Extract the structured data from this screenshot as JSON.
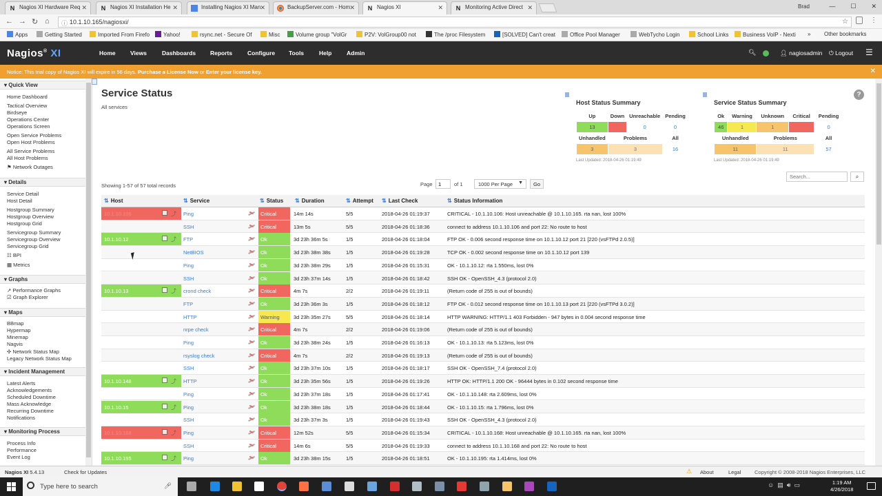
{
  "browser": {
    "tabs": [
      {
        "title": "Nagios XI Hardware Req",
        "favicon": "N"
      },
      {
        "title": "Nagios XI Installation He",
        "favicon": "N"
      },
      {
        "title": "Installing Nagios XI Man",
        "favicon": "doc"
      },
      {
        "title": "BackupServer.com - Hom",
        "favicon": "chrome"
      },
      {
        "title": "Nagios XI",
        "favicon": "N",
        "active": true
      },
      {
        "title": "Monitoring Active Direct",
        "favicon": "N"
      }
    ],
    "window_user": "Brad",
    "url": "10.1.10.165/nagiosxi/",
    "bookmarks": [
      "Apps",
      "Getting Started",
      "Imported From Firefo",
      "Yahoo!",
      "rsync.net - Secure Of",
      "Misc",
      "Volume group \"VolGr",
      "P2V: VolGroup00 not",
      "The /proc Filesystem",
      "[SOLVED] Can't creat",
      "Office Pool Manager",
      "WebTycho Login",
      "School Links",
      "Business VoIP - Nexti",
      "»",
      "Other bookmarks"
    ]
  },
  "header": {
    "logo_main": "Nagios",
    "logo_suffix": "XI",
    "nav": [
      "Home",
      "Views",
      "Dashboards",
      "Reports",
      "Configure",
      "Tools",
      "Help",
      "Admin"
    ],
    "user": "nagiosadmin",
    "logout": "Logout"
  },
  "notice": {
    "text": "Notice: This trial copy of Nagios XI will expire in 56 days.",
    "link1": "Purchase a License Now",
    "mid": "or",
    "link2": "Enter your license key."
  },
  "sidebar": {
    "sections": [
      {
        "title": "Quick View",
        "items": [
          "Home Dashboard",
          "Tactical Overview",
          "Birdseye",
          "Operations Center",
          "Operations Screen",
          "Open Service Problems",
          "Open Host Problems",
          "All Service Problems",
          "All Host Problems",
          "Network Outages"
        ]
      },
      {
        "title": "Details",
        "items": [
          "Service Detail",
          "Host Detail",
          "Hostgroup Summary",
          "Hostgroup Overview",
          "Hostgroup Grid",
          "Servicegroup Summary",
          "Servicegroup Overview",
          "Servicegroup Grid",
          "BPI",
          "Metrics"
        ]
      },
      {
        "title": "Graphs",
        "items": [
          "Performance Graphs",
          "Graph Explorer"
        ]
      },
      {
        "title": "Maps",
        "items": [
          "BBmap",
          "Hypermap",
          "Minemap",
          "Nagvis",
          "Network Status Map",
          "Legacy Network Status Map"
        ]
      },
      {
        "title": "Incident Management",
        "items": [
          "Latest Alerts",
          "Acknowledgements",
          "Scheduled Downtime",
          "Mass Acknowledge",
          "Recurring Downtime",
          "Notifications"
        ]
      },
      {
        "title": "Monitoring Process",
        "items": [
          "Process Info",
          "Performance",
          "Event Log"
        ]
      }
    ]
  },
  "main": {
    "title": "Service Status",
    "subtitle": "All services",
    "showing": "Showing 1-57 of 57 total records",
    "page_label": "Page",
    "page_value": "1",
    "page_of": "of 1",
    "per_page": "1000 Per Page",
    "go": "Go",
    "search_placeholder": "Search..."
  },
  "host_summary": {
    "title": "Host Status Summary",
    "headers": [
      "Up",
      "Down",
      "Unreachable",
      "Pending"
    ],
    "values": [
      "13",
      "3",
      "0",
      "0"
    ],
    "headers2": [
      "Unhandled",
      "Problems",
      "All"
    ],
    "values2": [
      "3",
      "3",
      "16"
    ],
    "last_updated": "Last Updated: 2018-04-26 01:19:49"
  },
  "service_summary": {
    "title": "Service Status Summary",
    "headers": [
      "Ok",
      "Warning",
      "Unknown",
      "Critical",
      "Pending"
    ],
    "values": [
      "46",
      "1",
      "1",
      "9",
      "0"
    ],
    "headers2": [
      "Unhandled",
      "Problems",
      "All"
    ],
    "values2": [
      "11",
      "11",
      "57"
    ],
    "last_updated": "Last Updated: 2018-04-26 01:19:49"
  },
  "table": {
    "headers": [
      "Host",
      "Service",
      "Status",
      "Duration",
      "Attempt",
      "Last Check",
      "Status Information"
    ],
    "rows": [
      {
        "host": "10.1.10.106",
        "host_state": "down",
        "service": "Ping",
        "status": "Critical",
        "duration": "14m 14s",
        "attempt": "5/5",
        "last_check": "2018-04-26 01:19:37",
        "info": "CRITICAL - 10.1.10.106: Host unreachable @ 10.1.10.165. rta nan, lost 100%"
      },
      {
        "host": "",
        "host_state": "",
        "service": "SSH",
        "status": "Critical",
        "duration": "13m 5s",
        "attempt": "5/5",
        "last_check": "2018-04-26 01:18:36",
        "info": "connect to address 10.1.10.106 and port 22: No route to host"
      },
      {
        "host": "10.1.10.12",
        "host_state": "up",
        "service": "FTP",
        "status": "Ok",
        "duration": "3d 23h 36m 5s",
        "attempt": "1/5",
        "last_check": "2018-04-26 01:18:04",
        "info": "FTP OK - 0.006 second response time on 10.1.10.12 port 21 [220 (vsFTPd 2.0.5)]"
      },
      {
        "host": "",
        "host_state": "",
        "service": "NetBIOS",
        "status": "Ok",
        "duration": "3d 23h 38m 38s",
        "attempt": "1/5",
        "last_check": "2018-04-26 01:19:28",
        "info": "TCP OK - 0.002 second response time on 10.1.10.12 port 139"
      },
      {
        "host": "",
        "host_state": "",
        "service": "Ping",
        "status": "Ok",
        "duration": "3d 23h 38m 29s",
        "attempt": "1/5",
        "last_check": "2018-04-26 01:15:31",
        "info": "OK - 10.1.10.12: rta 1.550ms, lost 0%"
      },
      {
        "host": "",
        "host_state": "",
        "service": "SSH",
        "status": "Ok",
        "duration": "3d 23h 37m 14s",
        "attempt": "1/5",
        "last_check": "2018-04-26 01:18:42",
        "info": "SSH OK - OpenSSH_4.3 (protocol 2.0)"
      },
      {
        "host": "10.1.10.13",
        "host_state": "up",
        "service": "crond check",
        "status": "Critical",
        "duration": "4m 7s",
        "attempt": "2/2",
        "last_check": "2018-04-26 01:19:11",
        "info": "(Return code of 255 is out of bounds)"
      },
      {
        "host": "",
        "host_state": "",
        "service": "FTP",
        "status": "Ok",
        "duration": "3d 23h 36m 3s",
        "attempt": "1/5",
        "last_check": "2018-04-26 01:18:12",
        "info": "FTP OK - 0.012 second response time on 10.1.10.13 port 21 [220 (vsFTPd 3.0.2)]"
      },
      {
        "host": "",
        "host_state": "",
        "service": "HTTP",
        "status": "Warning",
        "duration": "3d 23h 35m 27s",
        "attempt": "5/5",
        "last_check": "2018-04-26 01:18:14",
        "info": "HTTP WARNING: HTTP/1.1 403 Forbidden - 947 bytes in 0.004 second response time"
      },
      {
        "host": "",
        "host_state": "",
        "service": "nrpe check",
        "status": "Critical",
        "duration": "4m 7s",
        "attempt": "2/2",
        "last_check": "2018-04-26 01:19:06",
        "info": "(Return code of 255 is out of bounds)"
      },
      {
        "host": "",
        "host_state": "",
        "service": "Ping",
        "status": "Ok",
        "duration": "3d 23h 38m 24s",
        "attempt": "1/5",
        "last_check": "2018-04-26 01:16:13",
        "info": "OK - 10.1.10.13: rta 5.123ms, lost 0%"
      },
      {
        "host": "",
        "host_state": "",
        "service": "rsyslog check",
        "status": "Critical",
        "duration": "4m 7s",
        "attempt": "2/2",
        "last_check": "2018-04-26 01:19:13",
        "info": "(Return code of 255 is out of bounds)"
      },
      {
        "host": "",
        "host_state": "",
        "service": "SSH",
        "status": "Ok",
        "duration": "3d 23h 37m 10s",
        "attempt": "1/5",
        "last_check": "2018-04-26 01:18:17",
        "info": "SSH OK - OpenSSH_7.4 (protocol 2.0)"
      },
      {
        "host": "10.1.10.148",
        "host_state": "up",
        "service": "HTTP",
        "status": "Ok",
        "duration": "3d 23h 35m 56s",
        "attempt": "1/5",
        "last_check": "2018-04-26 01:19:26",
        "info": "HTTP OK: HTTP/1.1 200 OK - 96444 bytes in 0.102 second response time"
      },
      {
        "host": "",
        "host_state": "",
        "service": "Ping",
        "status": "Ok",
        "duration": "3d 23h 37m 18s",
        "attempt": "1/5",
        "last_check": "2018-04-26 01:17:41",
        "info": "OK - 10.1.10.148: rta 2.609ms, lost 0%"
      },
      {
        "host": "10.1.10.15",
        "host_state": "up",
        "service": "Ping",
        "status": "Ok",
        "duration": "3d 23h 38m 18s",
        "attempt": "1/5",
        "last_check": "2018-04-26 01:18:44",
        "info": "OK - 10.1.10.15: rta 1.796ms, lost 0%"
      },
      {
        "host": "",
        "host_state": "",
        "service": "SSH",
        "status": "Ok",
        "duration": "3d 23h 37m 3s",
        "attempt": "1/5",
        "last_check": "2018-04-26 01:19:43",
        "info": "SSH OK - OpenSSH_4.3 (protocol 2.0)"
      },
      {
        "host": "10.1.10.168",
        "host_state": "down",
        "service": "Ping",
        "status": "Critical",
        "duration": "12m 52s",
        "attempt": "5/5",
        "last_check": "2018-04-26 01:15:34",
        "info": "CRITICAL - 10.1.10.168: Host unreachable @ 10.1.10.165. rta nan, lost 100%"
      },
      {
        "host": "",
        "host_state": "",
        "service": "SSH",
        "status": "Critical",
        "duration": "14m 6s",
        "attempt": "5/5",
        "last_check": "2018-04-26 01:19:33",
        "info": "connect to address 10.1.10.168 and port 22: No route to host"
      },
      {
        "host": "10.1.10.195",
        "host_state": "up",
        "service": "Ping",
        "status": "Ok",
        "duration": "3d 23h 38m 15s",
        "attempt": "1/5",
        "last_check": "2018-04-26 01:18:51",
        "info": "OK - 10.1.10.195: rta 1.414ms, lost 0%"
      }
    ]
  },
  "footer": {
    "product": "Nagios XI",
    "version": "5.4.13",
    "check_updates": "Check for Updates",
    "about": "About",
    "legal": "Legal",
    "copyright": "Copyright © 2008-2018 Nagios Enterprises, LLC"
  },
  "taskbar": {
    "search_placeholder": "Type here to search",
    "time": "1:19 AM",
    "date": "4/26/2018"
  },
  "colors": {
    "ok": "#8fdc5a",
    "critical": "#f1675f",
    "warning": "#f5e94f",
    "notice": "#f0a030",
    "header": "#2d2d2d",
    "link": "#3a7bd5"
  }
}
